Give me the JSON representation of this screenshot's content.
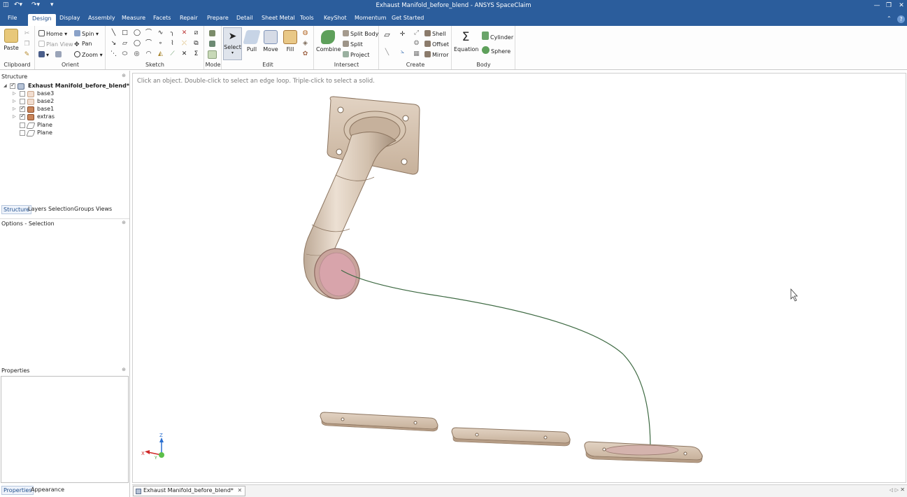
{
  "window": {
    "title": "Exhaust Manifold_before_blend - ANSYS SpaceClaim",
    "controls": [
      "—",
      "❐",
      "✕"
    ]
  },
  "menu_tabs": [
    "File",
    "Design",
    "Display",
    "Assembly",
    "Measure",
    "Facets",
    "Repair",
    "Prepare",
    "Detail",
    "Sheet Metal",
    "Tools",
    "KeyShot",
    "Momentum",
    "Get Started"
  ],
  "active_tab": "Design",
  "ribbon": {
    "clipboard": {
      "paste": "Paste",
      "label": "Clipboard"
    },
    "orient": {
      "home": "Home",
      "spin": "Spin",
      "plan_view": "Plan View",
      "pan": "Pan",
      "zoom": "Zoom",
      "label": "Orient"
    },
    "sketch": {
      "label": "Sketch"
    },
    "mode": {
      "label": "Mode"
    },
    "edit": {
      "select": "Select",
      "pull": "Pull",
      "move": "Move",
      "fill": "Fill",
      "label": "Edit"
    },
    "intersect": {
      "combine": "Combine",
      "split_body": "Split Body",
      "split": "Split",
      "project": "Project",
      "label": "Intersect"
    },
    "create": {
      "shell": "Shell",
      "offset": "Offset",
      "mirror": "Mirror",
      "label": "Create"
    },
    "body": {
      "equation": "Equation",
      "cylinder": "Cylinder",
      "sphere": "Sphere",
      "label": "Body"
    }
  },
  "structure": {
    "header": "Structure",
    "tree": [
      {
        "label": "Exhaust Manifold_before_blend*",
        "checked": true,
        "level": 0
      },
      {
        "label": "base3",
        "checked": false,
        "level": 1
      },
      {
        "label": "base2",
        "checked": false,
        "level": 1
      },
      {
        "label": "base1",
        "checked": true,
        "level": 1
      },
      {
        "label": "extras",
        "checked": true,
        "level": 1
      },
      {
        "label": "Plane",
        "checked": false,
        "level": 1
      },
      {
        "label": "Plane",
        "checked": false,
        "level": 1
      }
    ],
    "tabs": [
      "Structure",
      "Layers",
      "Selection",
      "Groups",
      "Views"
    ]
  },
  "options_header": "Options - Selection",
  "properties_header": "Properties",
  "bottom_tabs": [
    "Properties",
    "Appearance"
  ],
  "viewport_hint": "Click an object. Double-click to select an edge loop. Triple-click to select a solid.",
  "triad": {
    "z": "Z",
    "x": "X",
    "y": "Y"
  },
  "document_tab": "Exhaust Manifold_before_blend*",
  "colors": {
    "title_bar": "#2b5d9c",
    "part_body": "#d9c9b7",
    "selected_face": "#d8a4ab",
    "path_curve": "#3e6a43"
  }
}
